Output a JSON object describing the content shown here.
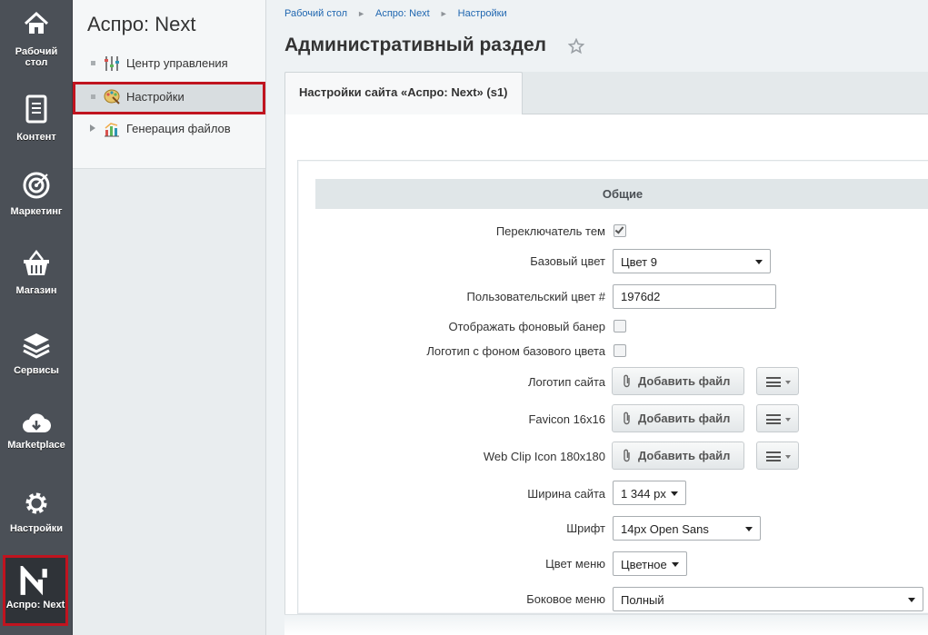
{
  "sidebar": {
    "items": [
      {
        "label_line1": "Рабочий",
        "label_line2": "стол",
        "icon": "home-icon"
      },
      {
        "label": "Контент",
        "icon": "document-icon"
      },
      {
        "label": "Маркетинг",
        "icon": "target-icon"
      },
      {
        "label": "Магазин",
        "icon": "basket-icon"
      },
      {
        "label": "Сервисы",
        "icon": "layers-icon"
      },
      {
        "label": "Marketplace",
        "icon": "cloud-download-icon"
      },
      {
        "label": "Настройки",
        "icon": "gear-icon"
      },
      {
        "label": "Аспро: Next",
        "icon": "aspro-next-logo-icon",
        "active": true
      }
    ]
  },
  "submenu": {
    "title": "Аспро: Next",
    "items": [
      {
        "label": "Центр управления",
        "icon": "sliders-icon"
      },
      {
        "label": "Настройки",
        "icon": "palette-icon",
        "selected": true
      },
      {
        "label": "Генерация файлов",
        "icon": "bar-chart-icon",
        "expandable": true
      }
    ]
  },
  "breadcrumb": [
    "Рабочий стол",
    "Аспро: Next",
    "Настройки"
  ],
  "page_title": "Административный раздел",
  "tab": {
    "label": "Настройки сайта «Аспро: Next» (s1)"
  },
  "section": {
    "title": "Общие"
  },
  "form": {
    "theme_switcher": {
      "label": "Переключатель тем",
      "checked": true
    },
    "base_color": {
      "label": "Базовый цвет",
      "value": "Цвет 9"
    },
    "custom_color": {
      "label": "Пользовательский цвет #",
      "value": "1976d2"
    },
    "bg_banner": {
      "label": "Отображать фоновый банер",
      "checked": false
    },
    "logo_bg": {
      "label": "Логотип с фоном базового цвета",
      "checked": false
    },
    "site_logo": {
      "label": "Логотип сайта",
      "button": "Добавить файл"
    },
    "favicon": {
      "label": "Favicon 16x16",
      "button": "Добавить файл"
    },
    "webclip": {
      "label": "Web Clip Icon 180x180",
      "button": "Добавить файл"
    },
    "site_width": {
      "label": "Ширина сайта",
      "value": "1 344 px"
    },
    "font": {
      "label": "Шрифт",
      "value": "14px Open Sans"
    },
    "menu_color": {
      "label": "Цвет меню",
      "value": "Цветное"
    },
    "side_menu": {
      "label": "Боковое меню",
      "value": "Полный"
    }
  },
  "colors": {
    "accent_red": "#c0141f",
    "link": "#2067b0",
    "iconbar": "#4b5057"
  }
}
